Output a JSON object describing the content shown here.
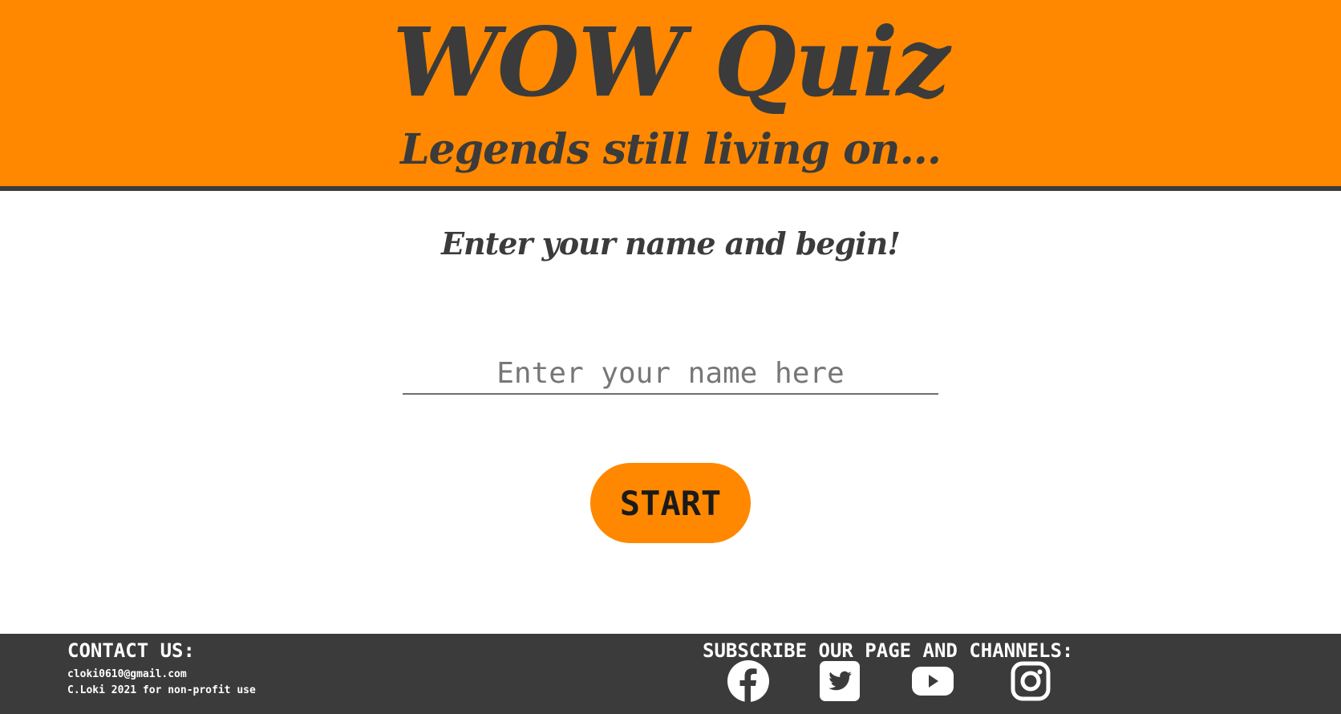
{
  "header": {
    "title": "WOW Quiz",
    "subtitle": "Legends still living on..."
  },
  "main": {
    "prompt": "Enter your name and begin!",
    "name_input": {
      "value": "",
      "placeholder": "Enter your name here"
    },
    "start_label": "START"
  },
  "footer": {
    "contact_heading": "CONTACT US:",
    "email": "cloki0610@gmail.com",
    "copyright": "C.Loki 2021 for non-profit use",
    "subscribe_heading": "SUBSCRIBE OUR PAGE AND CHANNELS:",
    "social_icons": [
      "facebook-icon",
      "twitter-icon",
      "youtube-icon",
      "instagram-icon"
    ]
  },
  "colors": {
    "accent": "#ff8800",
    "dark": "#3b3b3b",
    "background": "#ffffff"
  }
}
